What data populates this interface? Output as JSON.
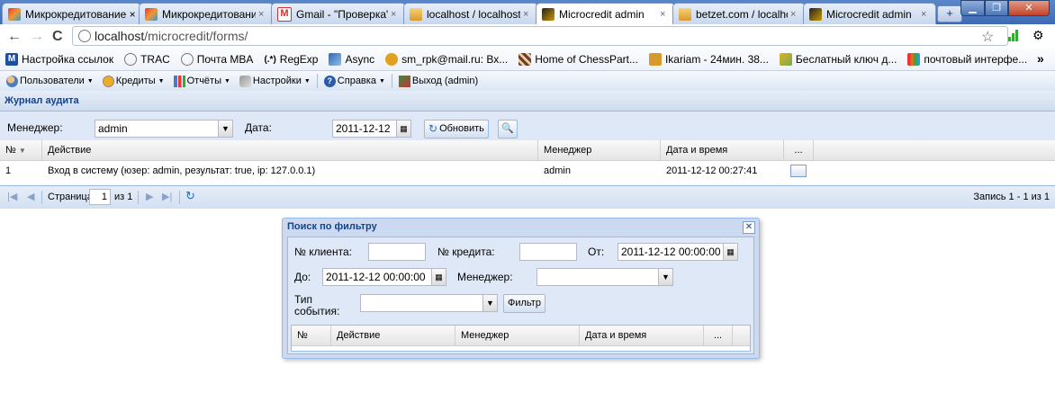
{
  "browser": {
    "tabs": [
      {
        "title": "Микрокредитование ×",
        "active": false,
        "icon": "rainbow-icon"
      },
      {
        "title": "Микрокредитовани",
        "active": false,
        "icon": "rainbow-icon"
      },
      {
        "title": "Gmail - \"Проверка\" (",
        "active": false,
        "icon": "gmail-icon"
      },
      {
        "title": "localhost / localhost",
        "active": false,
        "icon": "pma-icon"
      },
      {
        "title": "Microcredit admin",
        "active": true,
        "icon": "app-icon"
      },
      {
        "title": "betzet.com / localho",
        "active": false,
        "icon": "pma-icon"
      },
      {
        "title": "Microcredit admin",
        "active": false,
        "icon": "app-icon"
      }
    ],
    "tab_close": "×",
    "new_tab": "+",
    "url_host": "localhost",
    "url_path": "/microcredit/forms/",
    "back": "←",
    "forward": "→",
    "reload": "C",
    "star": "☆",
    "wrench": "🔧",
    "bookmarks": [
      {
        "label": "Настройка ссылок",
        "color": "#1c4f9c"
      },
      {
        "label": "TRAC",
        "color": "#8a8a8a"
      },
      {
        "label": "Почта MBA",
        "color": "#8a8a8a"
      },
      {
        "label": "RegExp",
        "color": "#333333"
      },
      {
        "label": "Async",
        "color": "#2a6bbf"
      },
      {
        "label": "sm_rpk@mail.ru: Вх...",
        "color": "#e0a020"
      },
      {
        "label": "Home of ChessPart...",
        "color": "#6b3d2e"
      },
      {
        "label": "Ikariam - 24мин. 38...",
        "color": "#d89a2c"
      },
      {
        "label": "Беслатный ключ д...",
        "color": "#e0b020"
      },
      {
        "label": "почтовый интерфе...",
        "color": "#d87020"
      }
    ],
    "bookmarks_more": "»"
  },
  "app_menu": [
    {
      "label": "Пользователи",
      "icon": "users-icon"
    },
    {
      "label": "Кредиты",
      "icon": "coin-icon"
    },
    {
      "label": "Отчёты",
      "icon": "chart-icon"
    },
    {
      "label": "Настройки",
      "icon": "wrench-icon"
    },
    {
      "label": "Справка",
      "icon": "help-icon"
    },
    {
      "label": "Выход (admin)",
      "icon": "exit-icon"
    }
  ],
  "audit_panel": {
    "title": "Журнал аудита",
    "manager_label": "Менеджер:",
    "manager_value": "admin",
    "date_label": "Дата:",
    "date_value": "2011-12-12",
    "refresh_label": "Обновить",
    "columns": [
      "№",
      "Действие",
      "Менеджер",
      "Дата и время",
      "..."
    ],
    "rows": [
      {
        "num": "1",
        "action": "Вход в систему (юзер: admin, результат: true, ip: 127.0.0.1)",
        "manager": "admin",
        "datetime": "2011-12-12 00:27:41"
      }
    ],
    "pager": {
      "page_label": "Страница",
      "page_value": "1",
      "of_label": "из 1",
      "record_info": "Запись 1 - 1 из 1"
    }
  },
  "filter_window": {
    "title": "Поиск по фильтру",
    "client_label": "№ клиента:",
    "client_value": "",
    "credit_label": "№ кредита:",
    "credit_value": "",
    "from_label": "От:",
    "from_value": "2011-12-12 00:00:00",
    "to_label": "До:",
    "to_value": "2011-12-12 00:00:00",
    "manager_label": "Менеджер:",
    "manager_value": "",
    "event_type_label_1": "Тип",
    "event_type_label_2": "события:",
    "event_type_value": "",
    "filter_button": "Фильтр",
    "columns": [
      "№",
      "Действие",
      "Менеджер",
      "Дата и время",
      "..."
    ]
  },
  "colors": {
    "panel_bg": "#dfe8f6",
    "header_text": "#15428b",
    "border": "#99bbe8"
  }
}
